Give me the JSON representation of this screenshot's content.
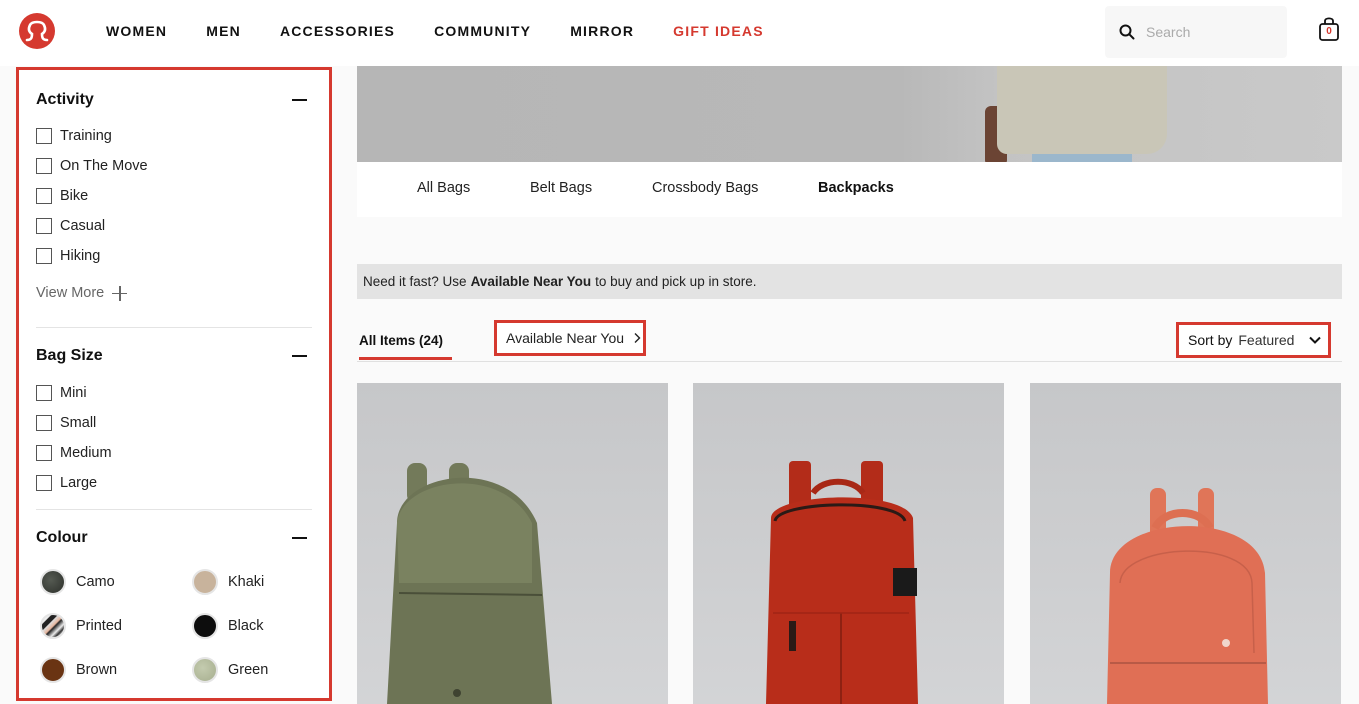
{
  "header": {
    "logo": "lululemon-logo",
    "nav": [
      {
        "label": "WOMEN"
      },
      {
        "label": "MEN"
      },
      {
        "label": "ACCESSORIES"
      },
      {
        "label": "COMMUNITY"
      },
      {
        "label": "MIRROR"
      },
      {
        "label": "GIFT IDEAS",
        "accent": true
      }
    ],
    "search": {
      "placeholder": "Search",
      "value": ""
    },
    "cart": {
      "count": "0"
    }
  },
  "sidebar": {
    "activity": {
      "title": "Activity",
      "options": [
        "Training",
        "On The Move",
        "Bike",
        "Casual",
        "Hiking"
      ],
      "view_more": "View More"
    },
    "bag_size": {
      "title": "Bag Size",
      "options": [
        "Mini",
        "Small",
        "Medium",
        "Large"
      ]
    },
    "colour": {
      "title": "Colour",
      "options": [
        {
          "label": "Camo",
          "color": "#3a3d38"
        },
        {
          "label": "Khaki",
          "color": "#c8b39c"
        },
        {
          "label": "Printed",
          "color": "#d0c8c0"
        },
        {
          "label": "Black",
          "color": "#0d0d0d"
        },
        {
          "label": "Brown",
          "color": "#6a3413"
        },
        {
          "label": "Green",
          "color": "#b3bb9c"
        }
      ]
    }
  },
  "main": {
    "subcategories": [
      {
        "label": "All Bags"
      },
      {
        "label": "Belt Bags"
      },
      {
        "label": "Crossbody Bags"
      },
      {
        "label": "Backpacks",
        "active": true
      }
    ],
    "notice": {
      "prefix": "Need it fast? Use",
      "bold": "Available Near You",
      "suffix": "to buy and pick up in store."
    },
    "all_items": "All Items (24)",
    "available_near_you": "Available Near You",
    "sort": {
      "label": "Sort by",
      "value": "Featured"
    },
    "products": [
      {
        "name": "green-backpack",
        "color": "#6d7455"
      },
      {
        "name": "red-backpack",
        "color": "#b82d1a"
      },
      {
        "name": "coral-backpack",
        "color": "#e06f55"
      }
    ]
  },
  "colors": {
    "accent": "#d5392f"
  }
}
